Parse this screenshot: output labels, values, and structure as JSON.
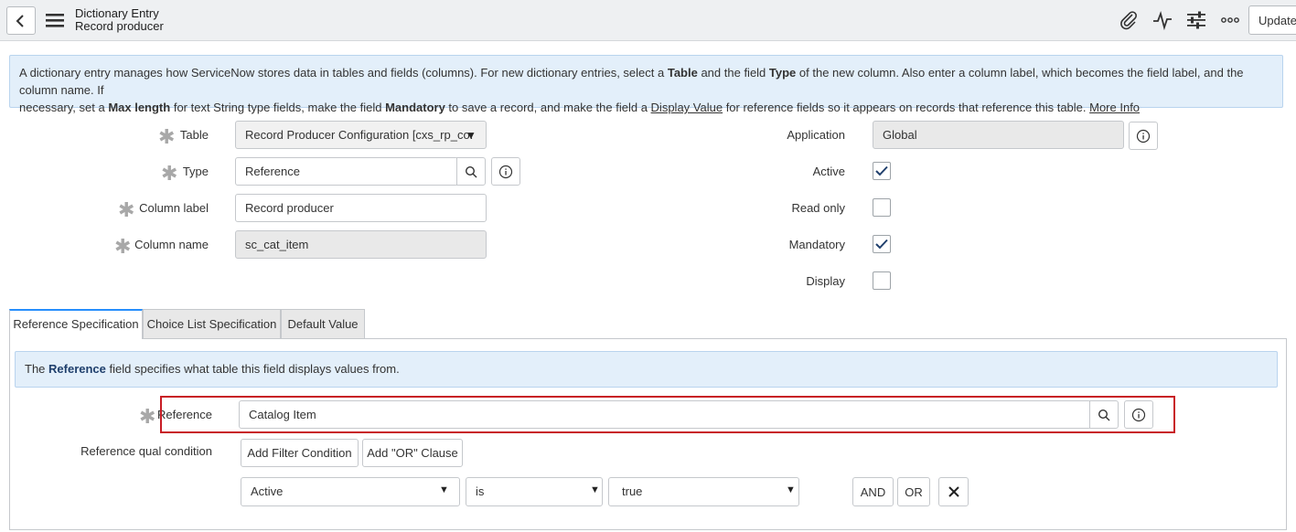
{
  "header": {
    "title": "Dictionary Entry",
    "subtitle": "Record producer",
    "update_label": "Update",
    "icons": [
      "back-icon",
      "menu-icon",
      "attachment-icon",
      "activity-icon",
      "settings-sliders-icon",
      "more-options-icon"
    ]
  },
  "banner": {
    "p1": "A dictionary entry manages how ServiceNow stores data in tables and fields (columns). For new dictionary entries, select a ",
    "b1": "Table",
    "p2": " and the field ",
    "b2": "Type",
    "p3": " of the new column. Also enter a column label, which becomes the field label, and the column name. If",
    "p4": "necessary, set a ",
    "b3": "Max length",
    "p5": " for text String type fields, make the field ",
    "b4": "Mandatory",
    "p6": " to save a record, and make the field a ",
    "u1": "Display Value",
    "p7": " for reference fields so it appears on records that reference this table. ",
    "more_info": "More Info"
  },
  "form": {
    "table_label": "Table",
    "table_value": "Record Producer Configuration [cxs_rp_co.",
    "type_label": "Type",
    "type_value": "Reference",
    "column_label_label": "Column label",
    "column_label_value": "Record producer",
    "column_name_label": "Column name",
    "column_name_value": "sc_cat_item",
    "application_label": "Application",
    "application_value": "Global",
    "active_label": "Active",
    "active_checked": true,
    "read_only_label": "Read only",
    "read_only_checked": false,
    "mandatory_label": "Mandatory",
    "mandatory_checked": true,
    "display_label": "Display",
    "display_checked": false
  },
  "tabs": [
    {
      "label": "Reference Specification",
      "active": true
    },
    {
      "label": "Choice List Specification",
      "active": false
    },
    {
      "label": "Default Value",
      "active": false
    }
  ],
  "reference_spec": {
    "banner_pre": "The ",
    "banner_bold": "Reference",
    "banner_post": " field specifies what table this field displays values from.",
    "reference_label": "Reference",
    "reference_value": "Catalog Item",
    "qual_label": "Reference qual condition",
    "add_filter_label": "Add Filter Condition",
    "add_or_label": "Add \"OR\" Clause",
    "condition": {
      "field": "Active",
      "operator": "is",
      "value": "true"
    },
    "and_label": "AND",
    "or_label": "OR"
  },
  "colors": {
    "accent_blue": "#278efc",
    "banner_bg": "#e3effa",
    "highlight_red": "#c81d25",
    "header_bg": "#eef0f2"
  }
}
